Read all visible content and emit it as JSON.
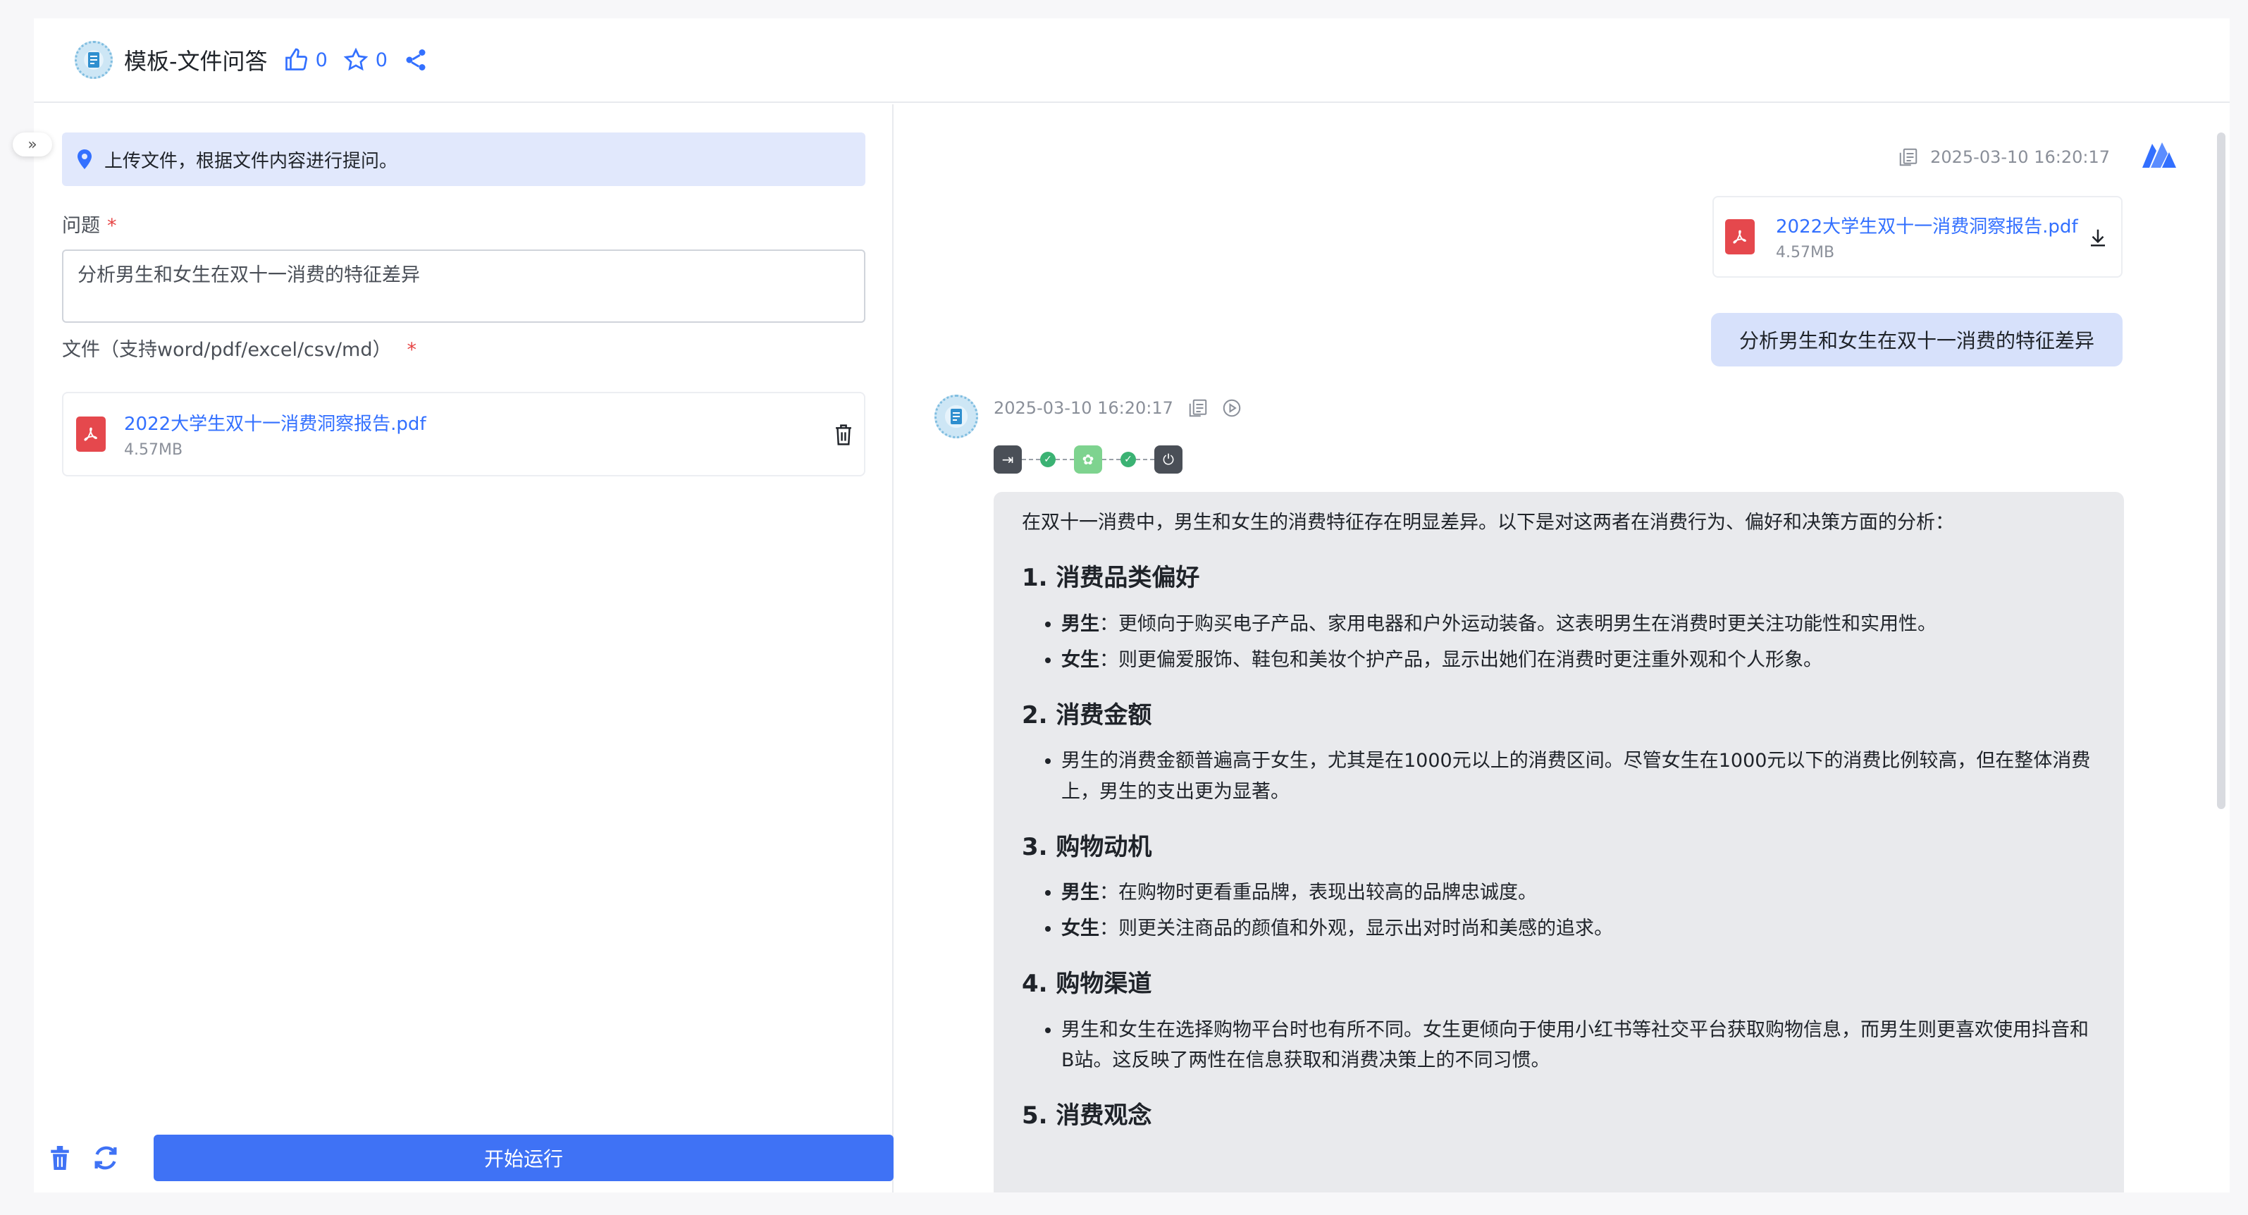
{
  "header": {
    "title": "模板-文件问答",
    "likes": "0",
    "stars": "0"
  },
  "left": {
    "tip": "上传文件，根据文件内容进行提问。",
    "question_label": "问题",
    "question_value": "分析男生和女生在双十一消费的特征差异",
    "file_label": "文件（支持word/pdf/excel/csv/md）",
    "required_mark": "*",
    "file": {
      "name": "2022大学生双十一消费洞察报告.pdf",
      "size": "4.57MB",
      "type_glyph": "⅄"
    },
    "run_label": "开始运行"
  },
  "chat": {
    "user_time": "2025-03-10 16:20:17",
    "user_file": {
      "name": "2022大学生双十一消费洞察报告.pdf",
      "size": "4.57MB"
    },
    "user_question": "分析男生和女生在双十一消费的特征差异",
    "bot_time": "2025-03-10 16:20:17",
    "answer": {
      "intro": "在双十一消费中，男生和女生的消费特征存在明显差异。以下是对这两者在消费行为、偏好和决策方面的分析：",
      "sections": [
        {
          "heading": "1. 消费品类偏好",
          "items": [
            {
              "bold": "男生",
              "text": "：更倾向于购买电子产品、家用电器和户外运动装备。这表明男生在消费时更关注功能性和实用性。"
            },
            {
              "bold": "女生",
              "text": "：则更偏爱服饰、鞋包和美妆个护产品，显示出她们在消费时更注重外观和个人形象。"
            }
          ]
        },
        {
          "heading": "2. 消费金额",
          "items": [
            {
              "bold": "",
              "text": "男生的消费金额普遍高于女生，尤其是在1000元以上的消费区间。尽管女生在1000元以下的消费比例较高，但在整体消费上，男生的支出更为显著。"
            }
          ]
        },
        {
          "heading": "3. 购物动机",
          "items": [
            {
              "bold": "男生",
              "text": "：在购物时更看重品牌，表现出较高的品牌忠诚度。"
            },
            {
              "bold": "女生",
              "text": "：则更关注商品的颜值和外观，显示出对时尚和美感的追求。"
            }
          ]
        },
        {
          "heading": "4. 购物渠道",
          "items": [
            {
              "bold": "",
              "text": "男生和女生在选择购物平台时也有所不同。女生更倾向于使用小红书等社交平台获取购物信息，而男生则更喜欢使用抖音和B站。这反映了两性在信息获取和消费决策上的不同习惯。"
            }
          ]
        },
        {
          "heading": "5. 消费观念",
          "items": []
        }
      ]
    }
  }
}
